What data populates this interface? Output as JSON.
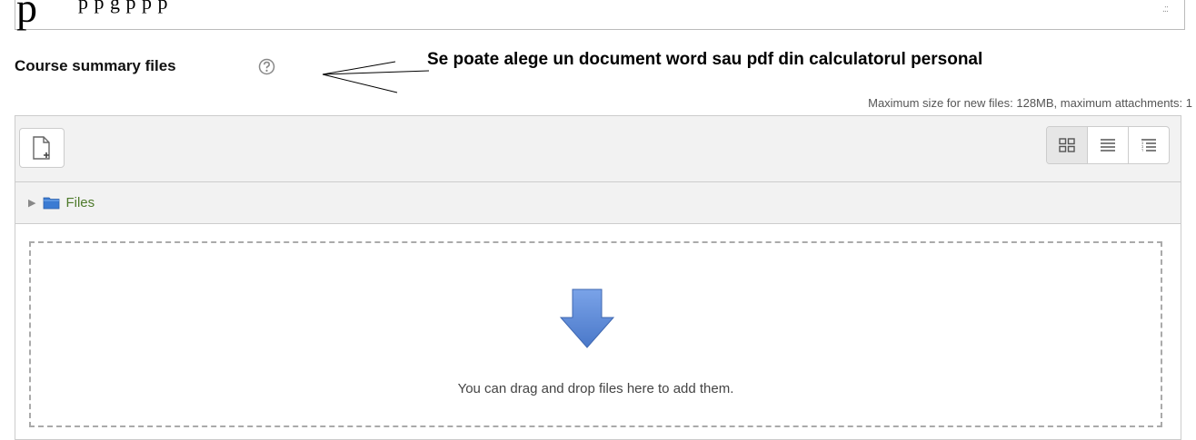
{
  "top_editor": {
    "glyph": "p",
    "remnant_text": "p        p      g    p      p  p",
    "resize_grip": ".::"
  },
  "section": {
    "label": "Course summary files",
    "help_icon": "help-circle-icon"
  },
  "annotation": {
    "text": "Se poate alege un document word sau pdf din calculatorul personal"
  },
  "limits": {
    "text": "Maximum size for new files: 128MB, maximum attachments: 1"
  },
  "toolbar": {
    "add_file_icon": "add-file-icon",
    "views": [
      "grid-view-icon",
      "list-view-icon",
      "tree-view-icon"
    ]
  },
  "path": {
    "toggle_icon": "triangle-right-icon",
    "folder_icon": "folder-icon",
    "label": "Files"
  },
  "dropzone": {
    "arrow_icon": "down-arrow-icon",
    "text": "You can drag and drop files here to add them."
  },
  "colors": {
    "folder_blue": "#3b7bd3",
    "arrow_blue": "#5a8ad6",
    "files_link_green": "#4e7a2b"
  }
}
